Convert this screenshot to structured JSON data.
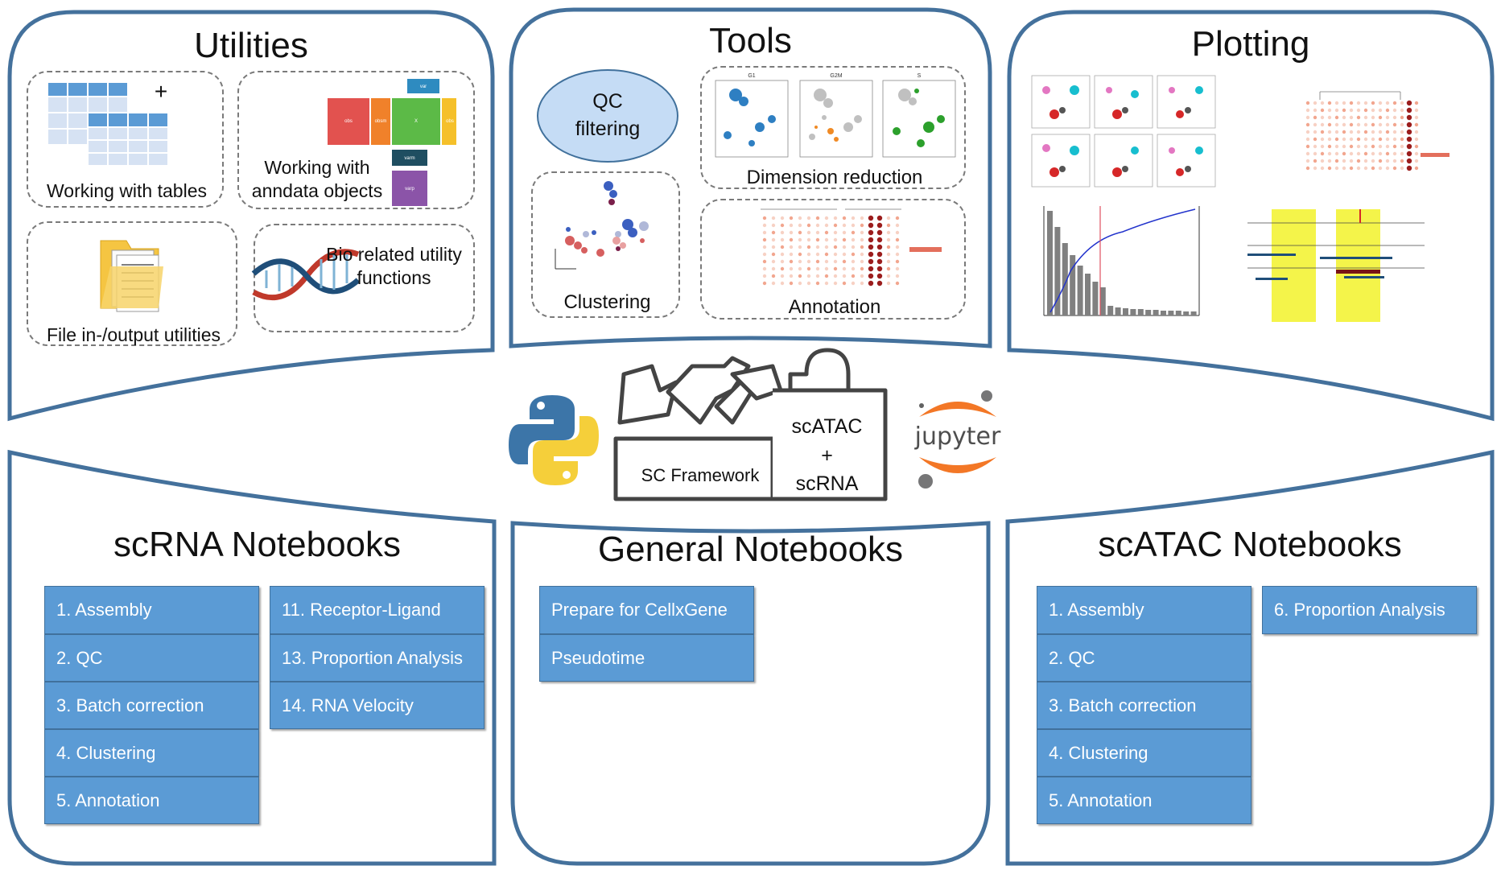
{
  "colors": {
    "border": "#44719c",
    "button": "#5b9bd5",
    "button_border": "#41719c",
    "qc_fill": "#c5dcf5"
  },
  "utilities": {
    "title": "Utilities",
    "items": [
      {
        "label": "Working with tables",
        "icon": "table-icon"
      },
      {
        "label": "Working with anndata objects",
        "icon": "anndata-icon"
      },
      {
        "label": "File in-/output utilities",
        "icon": "folder-icon"
      },
      {
        "label": "Bio related utility functions",
        "icon": "dna-icon"
      }
    ],
    "plus": "+",
    "anndata_blocks": [
      "obs",
      "obsm",
      "X",
      "var",
      "obs",
      "varm",
      "varp"
    ]
  },
  "tools": {
    "title": "Tools",
    "items": [
      {
        "label": "QC filtering"
      },
      {
        "label": "Clustering"
      },
      {
        "label": "Dimension reduction"
      },
      {
        "label": "Annotation"
      }
    ],
    "dimred_panels": [
      "G1",
      "G2M",
      "S"
    ]
  },
  "plotting": {
    "title": "Plotting"
  },
  "center": {
    "toolbox_label": "SC Framework",
    "toolbox_right_lines": [
      "scATAC",
      "+",
      "scRNA"
    ],
    "jupyter_text": "jupyter"
  },
  "scrna": {
    "title": "scRNA Notebooks",
    "col1": [
      "1. Assembly",
      "2. QC",
      "3. Batch correction",
      "4. Clustering",
      "5. Annotation"
    ],
    "col2": [
      "11. Receptor-Ligand",
      "13. Proportion Analysis",
      "14. RNA Velocity"
    ]
  },
  "general": {
    "title": "General Notebooks",
    "col1": [
      "Prepare for CellxGene",
      "Pseudotime"
    ]
  },
  "scatac": {
    "title": "scATAC Notebooks",
    "col1": [
      "1. Assembly",
      "2. QC",
      "3. Batch correction",
      "4. Clustering",
      "5. Annotation"
    ],
    "col2": [
      "6. Proportion Analysis"
    ]
  }
}
